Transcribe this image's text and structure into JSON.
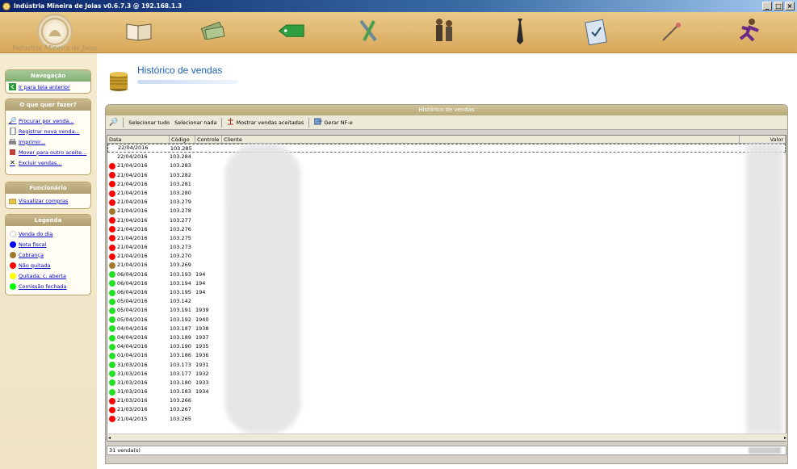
{
  "window": {
    "title": "Indústria Mineira de Joias v0.6.7.3 @ 192.168.1.3",
    "buttons": [
      "_",
      "□",
      "×"
    ]
  },
  "banner": {
    "logo_text": "Indústria Mineira de Joias",
    "icons": [
      "book-icon",
      "money-icon",
      "tag-icon",
      "tools-icon",
      "people-icon",
      "tie-icon",
      "clipboard-icon",
      "pin-icon",
      "running-man-icon"
    ]
  },
  "sidebar": {
    "nav": {
      "title": "Navegação",
      "items": [
        {
          "label": "Ir para tela anterior",
          "icon": "back-arrow-icon"
        }
      ]
    },
    "actions": {
      "title": "O que quer fazer?",
      "items": [
        {
          "label": "Procurar por venda...",
          "icon": "magnifier-icon"
        },
        {
          "label": "Registrar nova venda...",
          "icon": "document-icon"
        },
        {
          "label": "Imprimir...",
          "icon": "printer-icon"
        },
        {
          "label": "Mover para outro aceite...",
          "icon": "move-icon"
        },
        {
          "label": "Excluir vendas...",
          "icon": "delete-icon"
        }
      ]
    },
    "employee": {
      "title": "Funcionário",
      "items": [
        {
          "label": "Visualizar compras",
          "icon": "folder-icon"
        }
      ]
    },
    "legend": {
      "title": "Legenda",
      "items": [
        {
          "label": "Venda do dia",
          "color": "#ffffff"
        },
        {
          "label": "Nota fiscal",
          "color": "#0000ff"
        },
        {
          "label": "Cobrança",
          "color": "#a0782c"
        },
        {
          "label": "Não quitada",
          "color": "#ff0000"
        },
        {
          "label": "Quitada; c. aberta",
          "color": "#ffff00"
        },
        {
          "label": "Comissão fechada",
          "color": "#00ff00"
        }
      ]
    }
  },
  "main": {
    "title": "Histórico de vendas",
    "panel_title": "Histórico de vendas",
    "toolbar": {
      "select_all": "Selecionar tudo",
      "select_none": "Selecionar nada",
      "show_accepted": "Mostrar vendas aceitadas",
      "gen_nfe": "Gerar NF-e"
    },
    "columns": [
      "Data",
      "Código",
      "Controle",
      "Cliente",
      "Valor"
    ],
    "status": "31 venda(s)"
  },
  "colors": {
    "white": "#ffffff",
    "red": "#ff0000",
    "brown": "#a0782c",
    "green": "#22e022"
  },
  "rows": [
    {
      "date": "22/04/2016",
      "code": "103.285",
      "control": "",
      "status": "white"
    },
    {
      "date": "22/04/2016",
      "code": "103.284",
      "control": "",
      "status": "white"
    },
    {
      "date": "21/04/2016",
      "code": "103.283",
      "control": "",
      "status": "red"
    },
    {
      "date": "21/04/2016",
      "code": "103.282",
      "control": "",
      "status": "red"
    },
    {
      "date": "21/04/2016",
      "code": "103.281",
      "control": "",
      "status": "red"
    },
    {
      "date": "21/04/2016",
      "code": "103.280",
      "control": "",
      "status": "red"
    },
    {
      "date": "21/04/2016",
      "code": "103.279",
      "control": "",
      "status": "red"
    },
    {
      "date": "21/04/2016",
      "code": "103.278",
      "control": "",
      "status": "brown"
    },
    {
      "date": "21/04/2016",
      "code": "103.277",
      "control": "",
      "status": "red"
    },
    {
      "date": "21/04/2016",
      "code": "103.276",
      "control": "",
      "status": "red"
    },
    {
      "date": "21/04/2016",
      "code": "103.275",
      "control": "",
      "status": "red"
    },
    {
      "date": "21/04/2016",
      "code": "103.273",
      "control": "",
      "status": "red"
    },
    {
      "date": "21/04/2016",
      "code": "103.270",
      "control": "",
      "status": "red"
    },
    {
      "date": "21/04/2016",
      "code": "103.269",
      "control": "",
      "status": "brown"
    },
    {
      "date": "06/04/2016",
      "code": "103.193",
      "control": "194",
      "status": "green"
    },
    {
      "date": "06/04/2016",
      "code": "103.194",
      "control": "194",
      "status": "green"
    },
    {
      "date": "06/04/2016",
      "code": "103.195",
      "control": "194",
      "status": "green"
    },
    {
      "date": "05/04/2016",
      "code": "103.142",
      "control": "",
      "status": "green"
    },
    {
      "date": "05/04/2016",
      "code": "103.191",
      "control": "1939",
      "status": "green"
    },
    {
      "date": "05/04/2016",
      "code": "103.192",
      "control": "1940",
      "status": "green"
    },
    {
      "date": "04/04/2016",
      "code": "103.187",
      "control": "1938",
      "status": "green"
    },
    {
      "date": "04/04/2016",
      "code": "103.189",
      "control": "1937",
      "status": "green"
    },
    {
      "date": "04/04/2016",
      "code": "103.190",
      "control": "1935",
      "status": "green"
    },
    {
      "date": "01/04/2016",
      "code": "103.186",
      "control": "1936",
      "status": "green"
    },
    {
      "date": "31/03/2016",
      "code": "103.173",
      "control": "1931",
      "status": "green"
    },
    {
      "date": "31/03/2016",
      "code": "103.177",
      "control": "1932",
      "status": "green"
    },
    {
      "date": "31/03/2016",
      "code": "103.180",
      "control": "1933",
      "status": "green"
    },
    {
      "date": "31/03/2016",
      "code": "103.183",
      "control": "1934",
      "status": "green"
    },
    {
      "date": "21/03/2016",
      "code": "103.266",
      "control": "",
      "status": "red"
    },
    {
      "date": "21/03/2016",
      "code": "103.267",
      "control": "",
      "status": "red"
    },
    {
      "date": "21/04/2015",
      "code": "103.265",
      "control": "",
      "status": "red"
    }
  ]
}
